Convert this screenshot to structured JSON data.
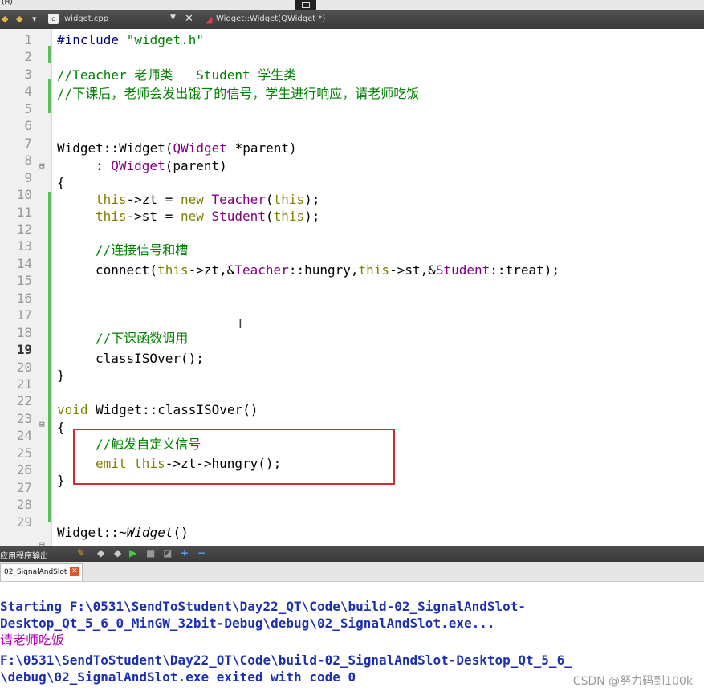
{
  "menu": {
    "label": "(H)"
  },
  "tabbar": {
    "file_name": "widget.cpp",
    "function_name": "Widget::Widget(QWidget *)"
  },
  "editor": {
    "current_line": 19,
    "lines": [
      {
        "n": "1"
      },
      {
        "n": "2"
      },
      {
        "n": "3"
      },
      {
        "n": "4"
      },
      {
        "n": "5"
      },
      {
        "n": "6"
      },
      {
        "n": "7"
      },
      {
        "n": "8"
      },
      {
        "n": "9"
      },
      {
        "n": "10"
      },
      {
        "n": "11"
      },
      {
        "n": "12"
      },
      {
        "n": "13"
      },
      {
        "n": "14"
      },
      {
        "n": "15"
      },
      {
        "n": "16"
      },
      {
        "n": "17"
      },
      {
        "n": "18"
      },
      {
        "n": "19"
      },
      {
        "n": "20"
      },
      {
        "n": "21"
      },
      {
        "n": "22"
      },
      {
        "n": "23"
      },
      {
        "n": "24"
      },
      {
        "n": "25"
      },
      {
        "n": "26"
      },
      {
        "n": "27"
      },
      {
        "n": "28"
      },
      {
        "n": "29"
      }
    ],
    "code": {
      "l1": [
        "#include ",
        "\"widget.h\""
      ],
      "l3": "//Teacher 老师类   Student 学生类",
      "l4": "//下课后，老师会发出饿了的信号，学生进行响应，请老师吃饭",
      "l7": [
        "Widget::Widget(",
        "QWidget",
        " *parent)"
      ],
      "l8": [
        ": ",
        "QWidget",
        "(parent)"
      ],
      "l9": "{",
      "l10": [
        "this",
        "->zt = ",
        "new",
        " ",
        "Teacher",
        "(",
        "this",
        ");"
      ],
      "l11": [
        "this",
        "->st = ",
        "new",
        " ",
        "Student",
        "(",
        "this",
        ");"
      ],
      "l13": "//连接信号和槽",
      "l14": [
        "connect(",
        "this",
        "->zt,&",
        "Teacher",
        "::hungry,",
        "this",
        "->st,&",
        "Student",
        "::treat);"
      ],
      "l18": "//下课函数调用",
      "l19": "classISOver();",
      "l20": "}",
      "l22": [
        "void",
        " Widget::classISOver()"
      ],
      "l23": "{",
      "l24": "//触发自定义信号",
      "l25": [
        "emit",
        " ",
        "this",
        "->zt->hungry();"
      ],
      "l26": "}",
      "l29": [
        "Widget::~",
        "Widget",
        "()"
      ]
    }
  },
  "output_panel": {
    "title": "应用程序输出",
    "tab_label": "02_SignalAndSlot",
    "lines": [
      "Starting F:\\0531\\SendToStudent\\Day22_QT\\Code\\build-02_SignalAndSlot-",
      "Desktop_Qt_5_6_0_MinGW_32bit-Debug\\debug\\02_SignalAndSlot.exe...",
      "请老师吃饭",
      "F:\\0531\\SendToStudent\\Day22_QT\\Code\\build-02_SignalAndSlot-Desktop_Qt_5_6_",
      "\\debug\\02_SignalAndSlot.exe exited with code 0"
    ]
  },
  "watermark": "CSDN @努力码到100k",
  "colors": {
    "keyword": "#808000",
    "type": "#800080",
    "comment": "#008000",
    "output_text": "#1c2fb3",
    "app_output": "#b000b0",
    "highlight_box": "#d42a36"
  }
}
